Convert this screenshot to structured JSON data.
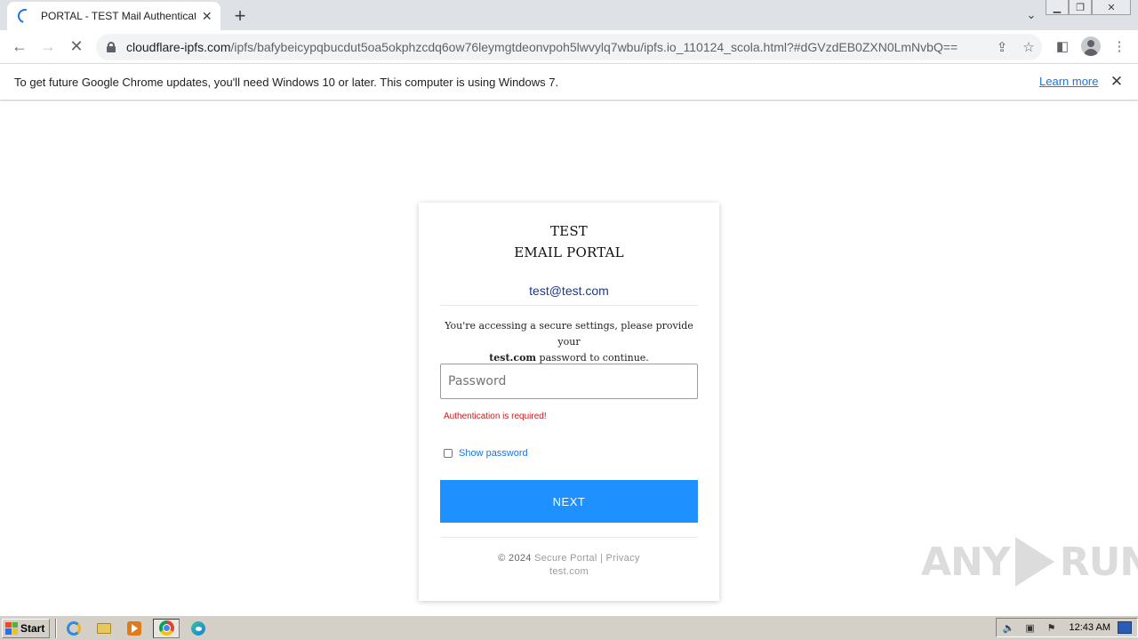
{
  "browser": {
    "tab_title": "PORTAL - TEST Mail Authentication",
    "url_host": "cloudflare-ipfs.com",
    "url_path": "/ipfs/bafybeicypqbucdut5oa5okphzcdq6ow76leymgtdeonvpoh5lwvylq7wbu/ipfs.io_110124_scola.html?#dGVzdEB0ZXN0LmNvbQ==",
    "infobar_text": "To get future Google Chrome updates, you'll need Windows 10 or later. This computer is using Windows 7.",
    "infobar_link": "Learn more"
  },
  "login": {
    "brand_line1": "TEST",
    "brand_line2": "EMAIL PORTAL",
    "email": "test@test.com",
    "notice_pre": "You're accessing a secure settings, please provide your",
    "notice_domain": "test.com",
    "notice_post": "password to continue.",
    "password_placeholder": "Password",
    "error": "Authentication is required!",
    "show_password_label": "Show password",
    "next_label": "NEXT",
    "footer_copyright": "© 2024",
    "footer_secure": "Secure Portal",
    "footer_separator": "|",
    "footer_privacy": "Privacy",
    "footer_domain": "test.com"
  },
  "watermark": {
    "left": "ANY",
    "right": "RUN"
  },
  "taskbar": {
    "start_label": "Start",
    "time": "12:43 AM"
  },
  "colors": {
    "accent": "#1e90ff",
    "error": "#d31919",
    "link": "#1a73e8",
    "email": "#1a3a8a"
  }
}
